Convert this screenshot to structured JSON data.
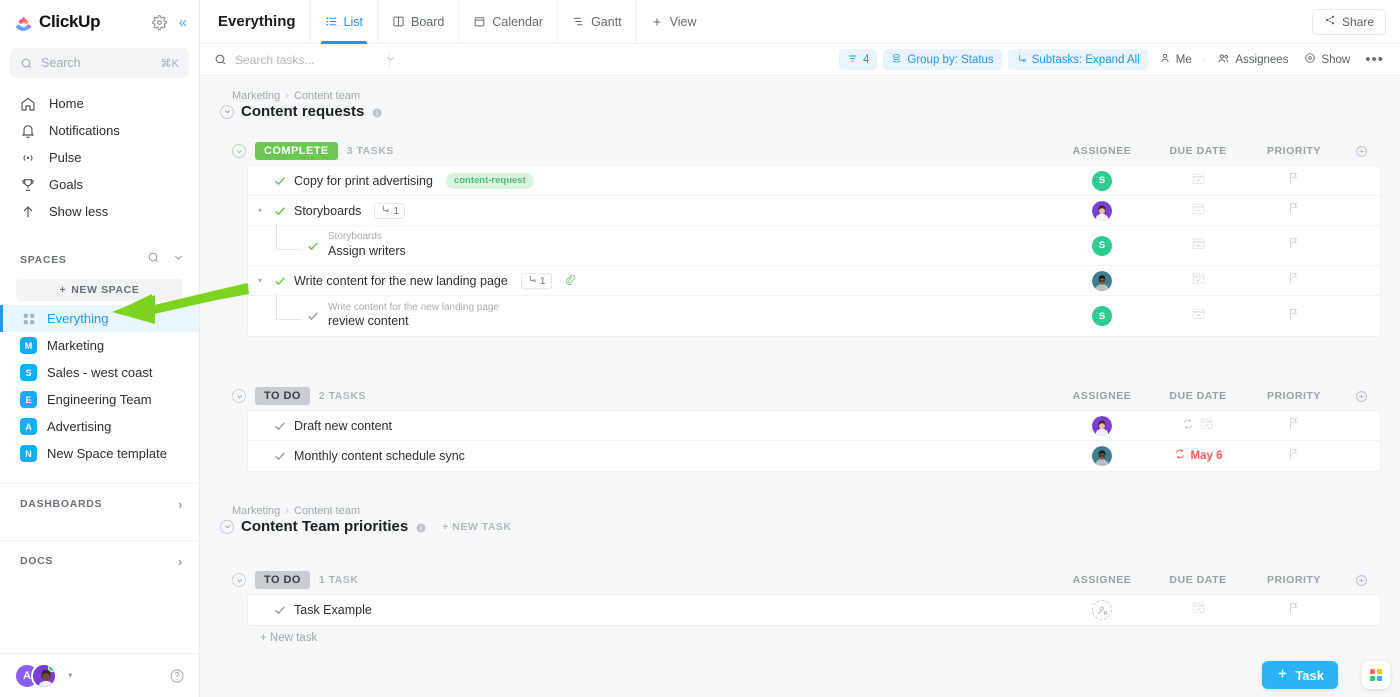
{
  "sidebar": {
    "logo_text": "ClickUp",
    "search": {
      "placeholder": "Search",
      "value": "",
      "shortcut": "⌘K"
    },
    "nav": [
      {
        "label": "Home",
        "icon": "home-icon"
      },
      {
        "label": "Notifications",
        "icon": "bell-icon"
      },
      {
        "label": "Pulse",
        "icon": "pulse-icon"
      },
      {
        "label": "Goals",
        "icon": "trophy-icon"
      },
      {
        "label": "Show less",
        "icon": "arrow-up-icon"
      }
    ],
    "spaces_header": "SPACES",
    "new_space_label": "NEW SPACE",
    "spaces": [
      {
        "label": "Everything",
        "badge": "",
        "active": true,
        "color": "#9fb4c4"
      },
      {
        "label": "Marketing",
        "badge": "M",
        "active": false,
        "color": "#17abfb"
      },
      {
        "label": "Sales - west coast",
        "badge": "S",
        "active": false,
        "color": "#17abfb"
      },
      {
        "label": "Engineering Team",
        "badge": "E",
        "active": false,
        "color": "#17abfb"
      },
      {
        "label": "Advertising",
        "badge": "A",
        "active": false,
        "color": "#17abfb"
      },
      {
        "label": "New Space template",
        "badge": "N",
        "active": false,
        "color": "#17abfb"
      }
    ],
    "dashboards_label": "DASHBOARDS",
    "docs_label": "DOCS",
    "avatar_initial": "A"
  },
  "topbar": {
    "view_title": "Everything",
    "tabs": [
      {
        "label": "List",
        "icon": "list-icon",
        "active": true
      },
      {
        "label": "Board",
        "icon": "board-icon",
        "active": false
      },
      {
        "label": "Calendar",
        "icon": "calendar-icon",
        "active": false
      },
      {
        "label": "Gantt",
        "icon": "gantt-icon",
        "active": false
      },
      {
        "label": "View",
        "icon": "plus-icon",
        "active": false
      }
    ],
    "share_label": "Share"
  },
  "toolbar": {
    "search_placeholder": "Search tasks...",
    "search_value": "",
    "filter_count": "4",
    "group_by_label": "Group by: Status",
    "subtasks_label": "Subtasks: Expand All",
    "me_label": "Me",
    "assignees_label": "Assignees",
    "show_label": "Show",
    "more_label": "•••"
  },
  "columns": {
    "assignee": "ASSIGNEE",
    "due_date": "DUE DATE",
    "priority": "PRIORITY"
  },
  "lists": [
    {
      "breadcrumb_parent": "Marketing",
      "breadcrumb_child": "Content team",
      "title": "Content requests",
      "new_task_label": "",
      "groups": [
        {
          "status": "COMPLETE",
          "status_color": "#6bc950",
          "count_label": "3 TASKS",
          "tasks": [
            {
              "name": "Copy for print advertising",
              "check": "green",
              "tag": "content-request",
              "assignee_type": "initial",
              "assignee_initial": "S",
              "assignee_color": "#2ecc8f",
              "due": "",
              "due_recurring": false
            },
            {
              "name": "Storyboards",
              "check": "green",
              "expandable": true,
              "subtask_count": "1",
              "assignee_type": "photo-female",
              "assignee_initial": "",
              "assignee_color": "#7b3fd4",
              "due": "",
              "due_recurring": false
            },
            {
              "name": "Assign writers",
              "parent_name": "Storyboards",
              "is_subtask": true,
              "check": "green",
              "assignee_type": "initial",
              "assignee_initial": "S",
              "assignee_color": "#2ecc8f",
              "due": "",
              "due_recurring": false
            },
            {
              "name": "Write content for the new landing page",
              "check": "green",
              "expandable": true,
              "subtask_count": "1",
              "has_attachment": true,
              "assignee_type": "photo-male",
              "assignee_initial": "",
              "assignee_color": "#3d7f8f",
              "due": "",
              "due_recurring": false
            },
            {
              "name": "review content",
              "parent_name": "Write content for the new landing page",
              "is_subtask": true,
              "check": "gray",
              "assignee_type": "initial",
              "assignee_initial": "S",
              "assignee_color": "#2ecc8f",
              "due": "",
              "due_recurring": false
            }
          ]
        },
        {
          "status": "TO DO",
          "status_color": "#c9ccd0",
          "count_label": "2 TASKS",
          "tasks": [
            {
              "name": "Draft new content",
              "check": "gray",
              "assignee_type": "photo-female",
              "assignee_initial": "",
              "assignee_color": "#7b3fd4",
              "due": "",
              "due_recurring": true
            },
            {
              "name": "Monthly content schedule sync",
              "check": "gray",
              "assignee_type": "photo-male",
              "assignee_initial": "",
              "assignee_color": "#3d7f8f",
              "due": "May 6",
              "due_recurring": true,
              "due_color": "#f45b5b"
            }
          ]
        }
      ]
    },
    {
      "breadcrumb_parent": "Marketing",
      "breadcrumb_child": "Content team",
      "title": "Content Team priorities",
      "new_task_label": "+ NEW TASK",
      "groups": [
        {
          "status": "TO DO",
          "status_color": "#c9ccd0",
          "count_label": "1 TASK",
          "tasks": [
            {
              "name": "Task Example",
              "check": "gray",
              "assignee_type": "empty",
              "assignee_initial": "",
              "assignee_color": "",
              "due": "",
              "due_recurring": false
            }
          ]
        }
      ],
      "add_row_label": "+ New task"
    }
  ],
  "fab": {
    "task_label": "Task"
  },
  "annotation": {
    "arrow_color": "#7ed321",
    "points_to": "Everything"
  }
}
